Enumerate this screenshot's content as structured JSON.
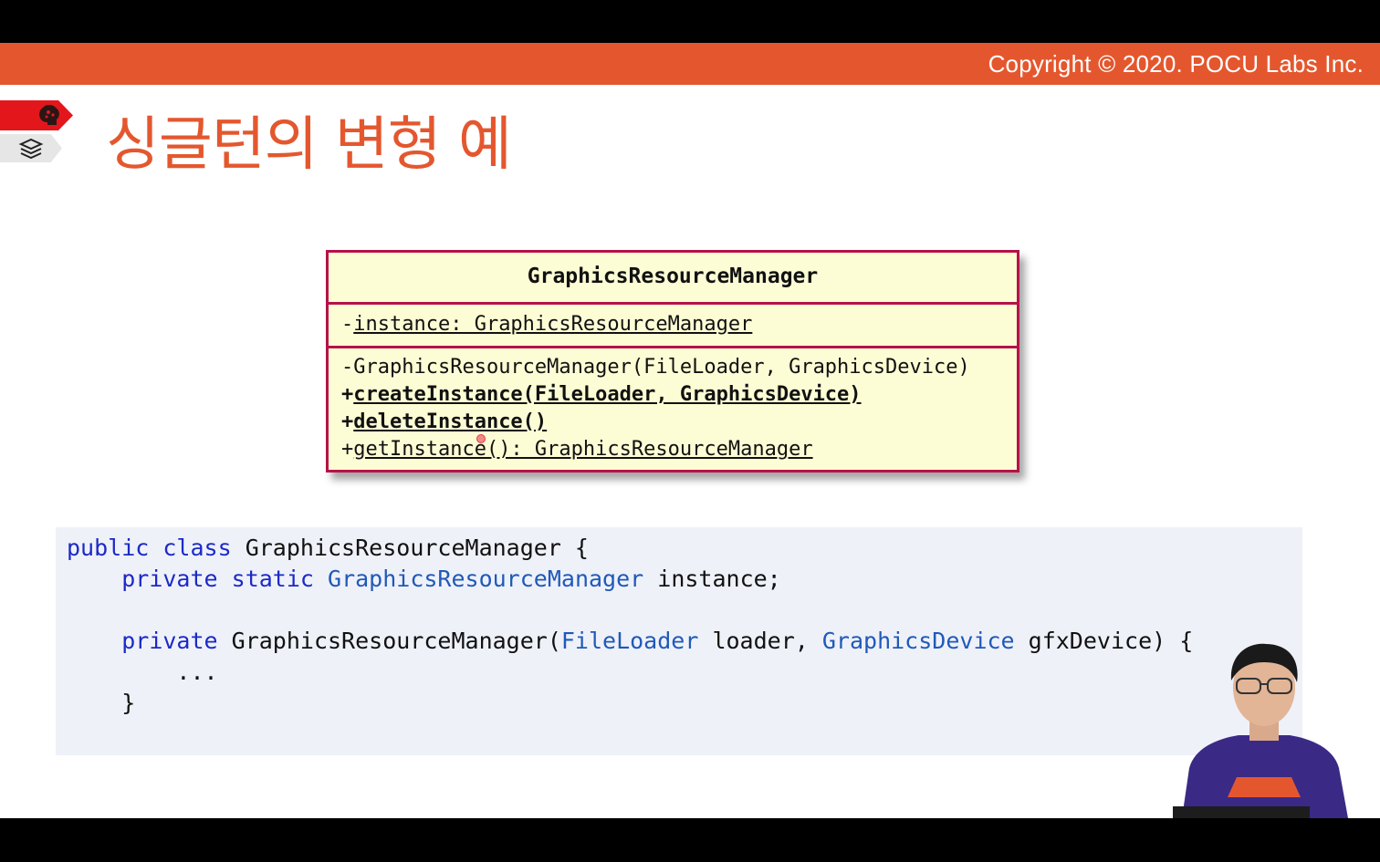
{
  "header": {
    "copyright": "Copyright © 2020. POCU Labs Inc."
  },
  "side_tags": [
    {
      "icon": "brain-icon",
      "color": "#e3171b"
    },
    {
      "icon": "books-icon",
      "color": "#e6e6e6"
    }
  ],
  "slide": {
    "title": "싱글턴의 변형 예"
  },
  "uml": {
    "class_name": "GraphicsResourceManager",
    "attribute": {
      "prefix": "-",
      "text": "instance: GraphicsResourceManager"
    },
    "operations": [
      {
        "prefix": "-",
        "text": "GraphicsResourceManager(FileLoader, GraphicsDevice)"
      },
      {
        "prefix": "+",
        "text": "createInstance(FileLoader, GraphicsDevice)"
      },
      {
        "prefix": "+",
        "text": "deleteInstance()"
      },
      {
        "prefix": "+",
        "text": "getInstance(): GraphicsResourceManager"
      }
    ],
    "colors": {
      "background": "#fdfdd5",
      "border": "#b5124b"
    }
  },
  "code": {
    "line1": {
      "kw1": "public",
      "kw2": "class",
      "rest": "GraphicsResourceManager {"
    },
    "line2": {
      "kw1": "private",
      "kw2": "static",
      "type": "GraphicsResourceManager",
      "rest": "instance;"
    },
    "line4": {
      "kw1": "private",
      "name": "GraphicsResourceManager(",
      "type1": "FileLoader",
      "mid": "loader,",
      "type2": "GraphicsDevice",
      "rest": "gfxDevice) {"
    },
    "line5": "...",
    "line6": "}"
  },
  "colors": {
    "accent": "#e4572e",
    "keyword": "#1b2ac6",
    "code_background": "#eff1f9"
  }
}
